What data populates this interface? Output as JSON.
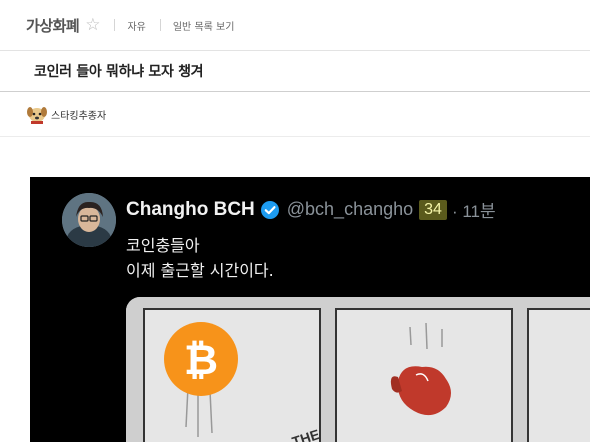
{
  "header": {
    "gallery_name": "가상화폐",
    "star_icon": "star-outline-icon",
    "crumbs": [
      "자유",
      "일반 목록 보기"
    ]
  },
  "post": {
    "title": "코인러 들아 뭐하냐 모자 챙겨",
    "author": {
      "name": "스타킹추종자",
      "avatar_icon": "dog-avatar-icon"
    }
  },
  "tweet": {
    "display_name": "Changho BCH",
    "verified_icon": "verified-badge-icon",
    "handle": "@bch_changho",
    "badge": "34",
    "time": "· 11분",
    "lines": [
      "코인충들아",
      "이제 출근할 시간이다."
    ],
    "media": {
      "coin_symbol": "₿",
      "corner_text": "THE"
    },
    "colors": {
      "bitcoin": "#F7931A",
      "verified": "#1D9BF0",
      "background": "#000000"
    }
  }
}
